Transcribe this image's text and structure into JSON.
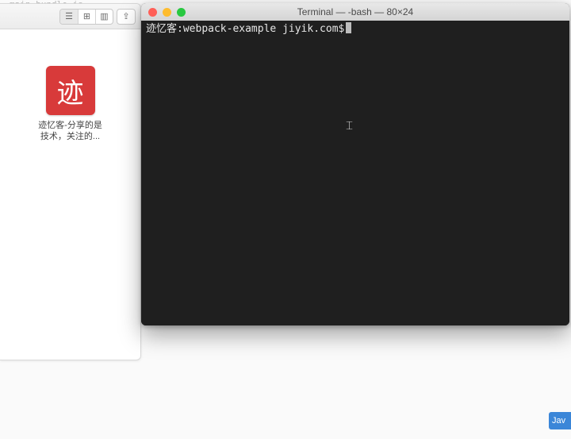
{
  "bg_editor_line": "main_bundle.js",
  "finder": {
    "file_icon_glyph": "迹",
    "file_label_line1": "迹忆客-分享的是",
    "file_label_line2": "技术，关注的..."
  },
  "terminal": {
    "title": "Terminal — -bash — 80×24",
    "prompt_user": "迹忆客",
    "prompt_sep": ":",
    "prompt_dir": "webpack-example",
    "prompt_host": "jiyik.com$"
  },
  "fragment": {
    "label": "Jav"
  },
  "icons": {
    "list": "☰",
    "grid": "⊞",
    "columns": "▥",
    "share": "⇪"
  }
}
